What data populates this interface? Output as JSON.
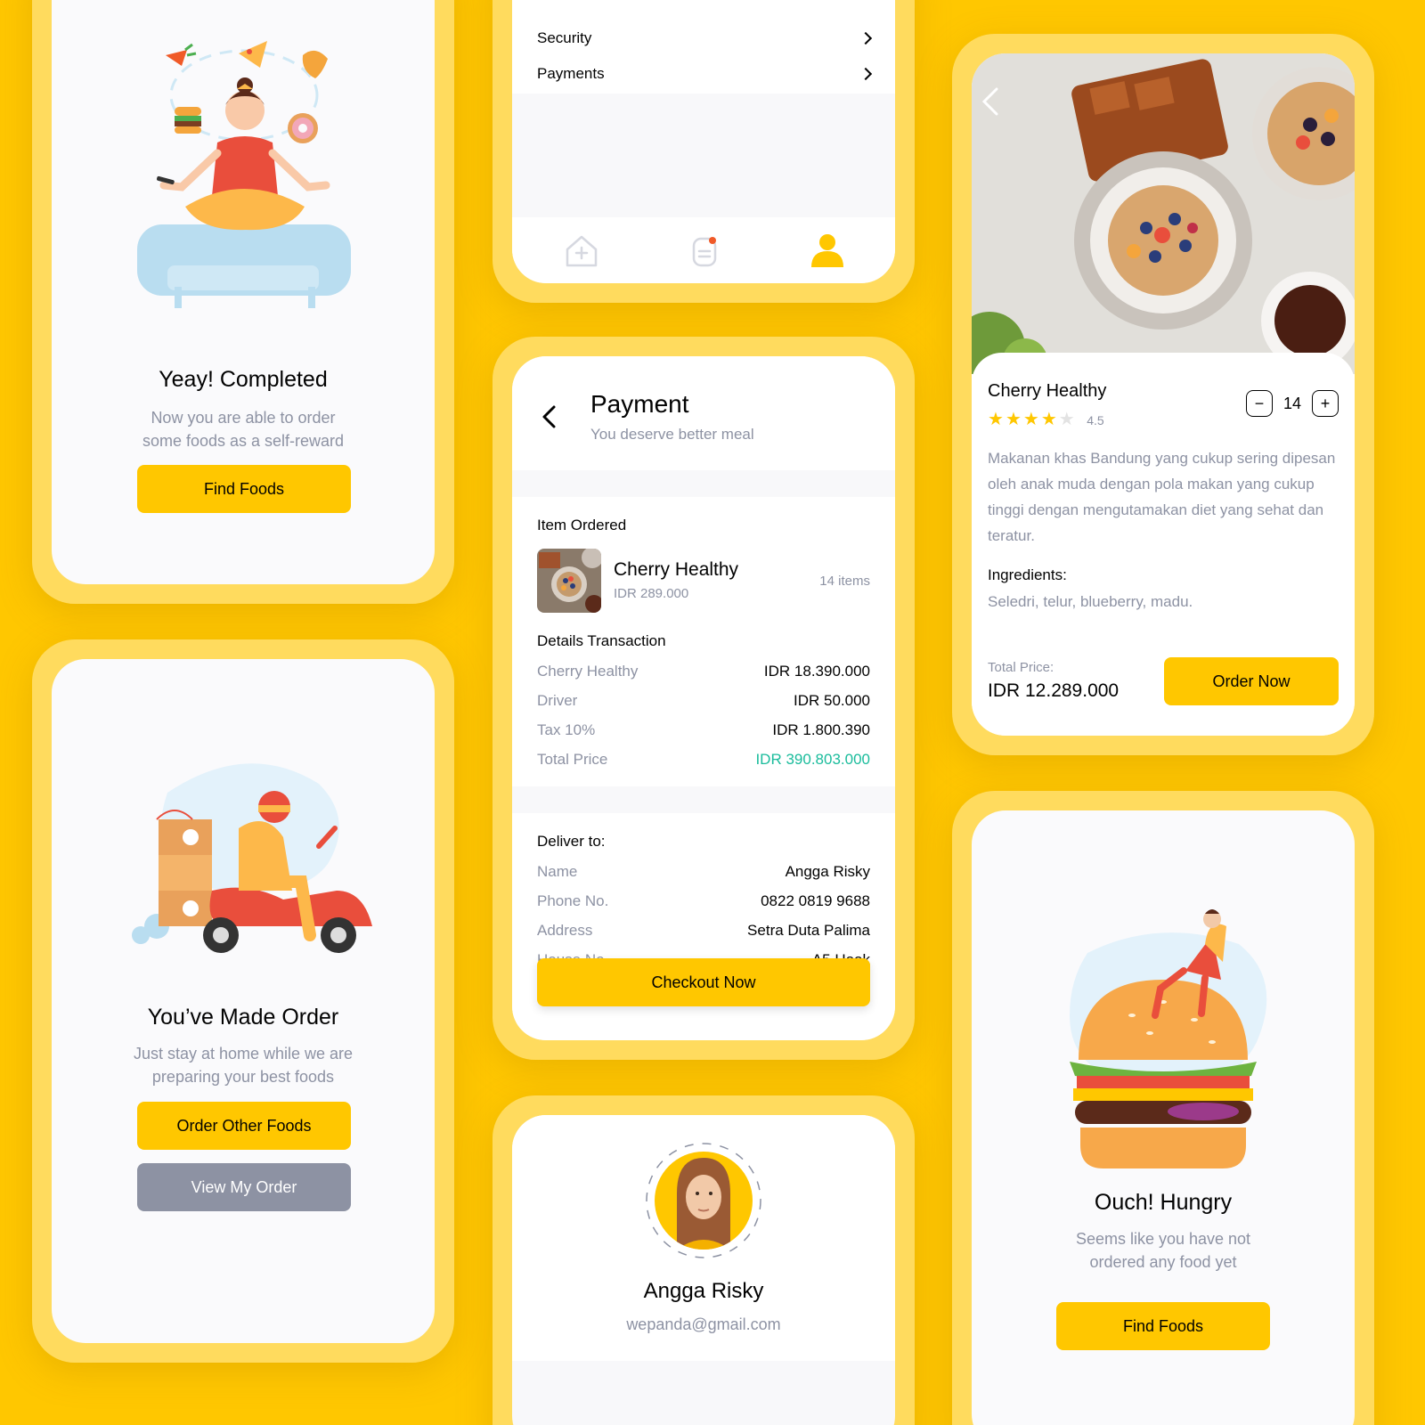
{
  "completed": {
    "title": "Yeay! Completed",
    "subtitle_line1": "Now you are able to order",
    "subtitle_line2": "some foods as a self-reward",
    "button": "Find Foods"
  },
  "made_order": {
    "title": "You’ve Made Order",
    "subtitle_line1": "Just stay at home while we are",
    "subtitle_line2": "preparing your best foods",
    "primary_button": "Order Other Foods",
    "secondary_button": "View My Order"
  },
  "profile_menu": {
    "items": [
      {
        "label": "Security"
      },
      {
        "label": "Payments"
      }
    ],
    "nav": [
      "home-icon",
      "order-icon",
      "profile-icon"
    ],
    "active_nav": 2
  },
  "payment": {
    "title": "Payment",
    "subtitle": "You deserve better meal",
    "item_ordered_label": "Item Ordered",
    "item": {
      "name": "Cherry Healthy",
      "price": "IDR 289.000",
      "qty": "14 items"
    },
    "details_label": "Details Transaction",
    "details": [
      {
        "label": "Cherry Healthy",
        "value": "IDR 18.390.000"
      },
      {
        "label": "Driver",
        "value": "IDR 50.000"
      },
      {
        "label": "Tax 10%",
        "value": "IDR 1.800.390"
      },
      {
        "label": "Total Price",
        "value": "IDR 390.803.000"
      }
    ],
    "deliver_label": "Deliver to:",
    "deliver": [
      {
        "label": "Name",
        "value": "Angga Risky"
      },
      {
        "label": "Phone No.",
        "value": "0822 0819 9688"
      },
      {
        "label": "Address",
        "value": "Setra Duta Palima"
      },
      {
        "label": "House No.",
        "value": "A5 Hook"
      }
    ],
    "checkout_button": "Checkout Now",
    "total_color": "#1ABC9C"
  },
  "profile": {
    "name": "Angga Risky",
    "email": "wepanda@gmail.com"
  },
  "detail": {
    "name": "Cherry Healthy",
    "rating": "4.5",
    "stars_filled": 4,
    "stars_total": 5,
    "quantity": "14",
    "minus": "−",
    "plus": "+",
    "description": "Makanan khas Bandung yang cukup sering dipesan oleh anak muda dengan pola makan yang cukup tinggi dengan mengutamakan diet yang sehat dan teratur.",
    "ingredients_label": "Ingredients:",
    "ingredients": "Seledri, telur, blueberry, madu.",
    "total_label": "Total Price:",
    "total_value": "IDR 12.289.000",
    "order_button": "Order Now"
  },
  "hungry": {
    "title": "Ouch! Hungry",
    "subtitle_line1": "Seems like you have not",
    "subtitle_line2": "ordered any food yet",
    "button": "Find Foods"
  },
  "colors": {
    "background": "#FFC700",
    "bezel": "#FFDB5E",
    "primary": "#FFC700",
    "gray_button": "#8D92A3",
    "muted_text": "#8D92A3",
    "success": "#1ABC9C"
  }
}
